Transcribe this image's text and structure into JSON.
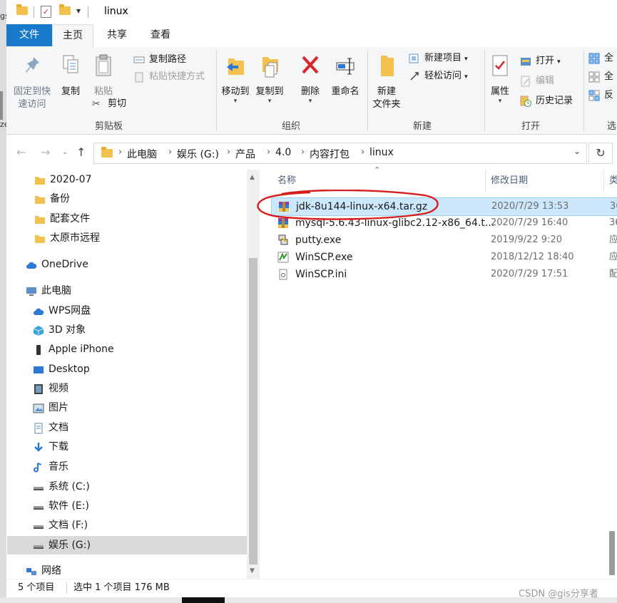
{
  "window": {
    "title": "linux"
  },
  "frame_left": {
    "texts": [
      "gs",
      "ze"
    ]
  },
  "quick_access": {
    "dropdown_glyph": "▾"
  },
  "tabs": [
    {
      "label": "文件"
    },
    {
      "label": "主页"
    },
    {
      "label": "共享"
    },
    {
      "label": "查看"
    }
  ],
  "ribbon": {
    "clipboard": {
      "pin_label_1": "固定到快",
      "pin_label_2": "速访问",
      "copy_label": "复制",
      "paste_label": "粘贴",
      "copy_path_label": "复制路径",
      "paste_shortcut_label": "粘贴快捷方式",
      "cut_label": "剪切",
      "group_label": "剪贴板"
    },
    "organize": {
      "move_to_label": "移动到",
      "copy_to_label": "复制到",
      "delete_label": "删除",
      "rename_label": "重命名",
      "group_label": "组织"
    },
    "new": {
      "new_folder_label_1": "新建",
      "new_folder_label_2": "文件夹",
      "new_item_label": "新建项目",
      "easy_access_label": "轻松访问",
      "group_label": "新建"
    },
    "open": {
      "properties_label": "属性",
      "open_label": "打开",
      "edit_label": "编辑",
      "history_label": "历史记录",
      "group_label": "打开"
    },
    "select": {
      "item1": "全",
      "item2": "全",
      "item3": "反",
      "group_label": "选"
    }
  },
  "address": {
    "breadcrumbs": [
      "此电脑",
      "娱乐 (G:)",
      "产品",
      "4.0",
      "内容打包",
      "linux"
    ]
  },
  "nav": {
    "items": [
      {
        "label": "2020-07",
        "icon": "folder-icon"
      },
      {
        "label": "备份",
        "icon": "folder-icon"
      },
      {
        "label": "配套文件",
        "icon": "folder-icon"
      },
      {
        "label": "太原市远程",
        "icon": "folder-icon"
      },
      {
        "label": "OneDrive",
        "icon": "cloud-icon"
      },
      {
        "label": "此电脑",
        "icon": "computer-icon"
      },
      {
        "label": "WPS网盘",
        "icon": "cloud-icon"
      },
      {
        "label": "3D 对象",
        "icon": "cube-icon"
      },
      {
        "label": "Apple iPhone",
        "icon": "phone-icon"
      },
      {
        "label": "Desktop",
        "icon": "desktop-icon"
      },
      {
        "label": "视频",
        "icon": "video-icon"
      },
      {
        "label": "图片",
        "icon": "picture-icon"
      },
      {
        "label": "文档",
        "icon": "document-icon"
      },
      {
        "label": "下载",
        "icon": "download-icon"
      },
      {
        "label": "音乐",
        "icon": "music-icon"
      },
      {
        "label": "系统 (C:)",
        "icon": "drive-icon"
      },
      {
        "label": "软件 (E:)",
        "icon": "drive-icon"
      },
      {
        "label": "文档 (F:)",
        "icon": "drive-icon"
      },
      {
        "label": "娱乐 (G:)",
        "icon": "drive-icon"
      },
      {
        "label": "网络",
        "icon": "network-icon"
      }
    ]
  },
  "columns": {
    "name": "名称",
    "date": "修改日期",
    "type": "类"
  },
  "files": [
    {
      "name": "jdk-8u144-linux-x64.tar.gz",
      "date": "2020/7/29 13:53",
      "type": "36",
      "icon": "archive-icon"
    },
    {
      "name": "mysql-5.6.43-linux-glibc2.12-x86_64.t...",
      "date": "2020/7/29 16:40",
      "type": "36",
      "icon": "archive-icon"
    },
    {
      "name": "putty.exe",
      "date": "2019/9/22 9:20",
      "type": "应",
      "icon": "putty-icon"
    },
    {
      "name": "WinSCP.exe",
      "date": "2018/12/12 18:40",
      "type": "应",
      "icon": "winscp-icon"
    },
    {
      "name": "WinSCP.ini",
      "date": "2020/7/29 17:51",
      "type": "配",
      "icon": "ini-file-icon"
    }
  ],
  "status": {
    "count": "5 个项目",
    "selection": "选中 1 个项目  176 MB"
  },
  "watermark": "CSDN @gis分享者",
  "colors": {
    "file_tab": "#1979ca",
    "selected_row": "#cce8ff",
    "annotation": "#d81e1e"
  }
}
